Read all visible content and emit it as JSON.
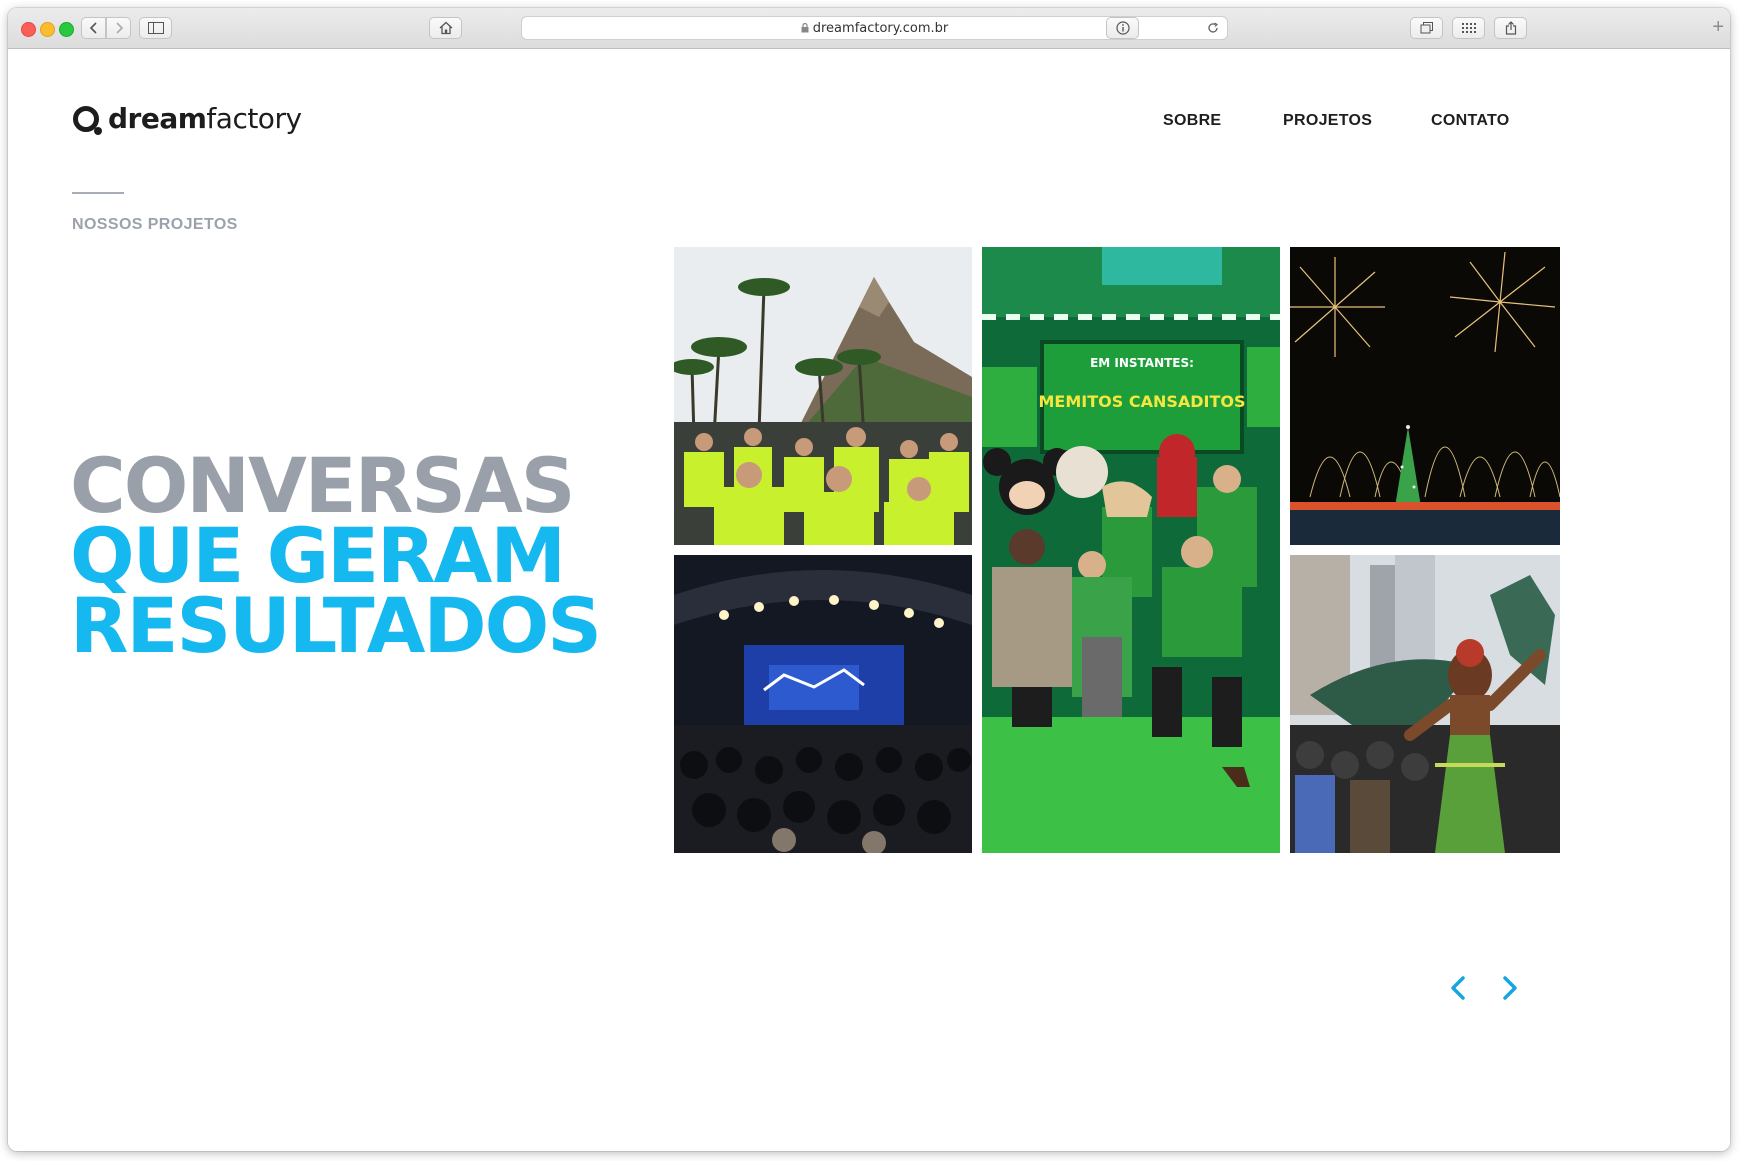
{
  "browser": {
    "url": "dreamfactory.com.br"
  },
  "site": {
    "logo": {
      "bold": "dream",
      "light": "factory"
    },
    "nav": [
      {
        "label": "SOBRE"
      },
      {
        "label": "PROJETOS"
      },
      {
        "label": "CONTATO"
      }
    ],
    "section_label": "NOSSOS PROJETOS",
    "headline": {
      "line1": "CONVERSAS",
      "line2": "QUE GERAM",
      "line3": "RESULTADOS"
    },
    "gallery": [
      {
        "subject": "marathon runners with palm trees and mountain"
      },
      {
        "subject": "group photo on green TV show stage with mascots"
      },
      {
        "subject": "fireworks over lagoon with illuminated tree"
      },
      {
        "subject": "concert hall with stage and audience"
      },
      {
        "subject": "carnival dancer in costume on street"
      }
    ],
    "stage_sign": {
      "line1": "EM INSTANTES:",
      "line2": "MEMITOS CANSADITOS"
    },
    "colors": {
      "headline_gray": "#9aa0a9",
      "headline_blue": "#16b8f0",
      "nav_text": "#1e1e1e",
      "arrow_blue": "#16a4e2"
    },
    "controls": {
      "prev_icon": "chevron-left-icon",
      "next_icon": "chevron-right-icon"
    }
  }
}
